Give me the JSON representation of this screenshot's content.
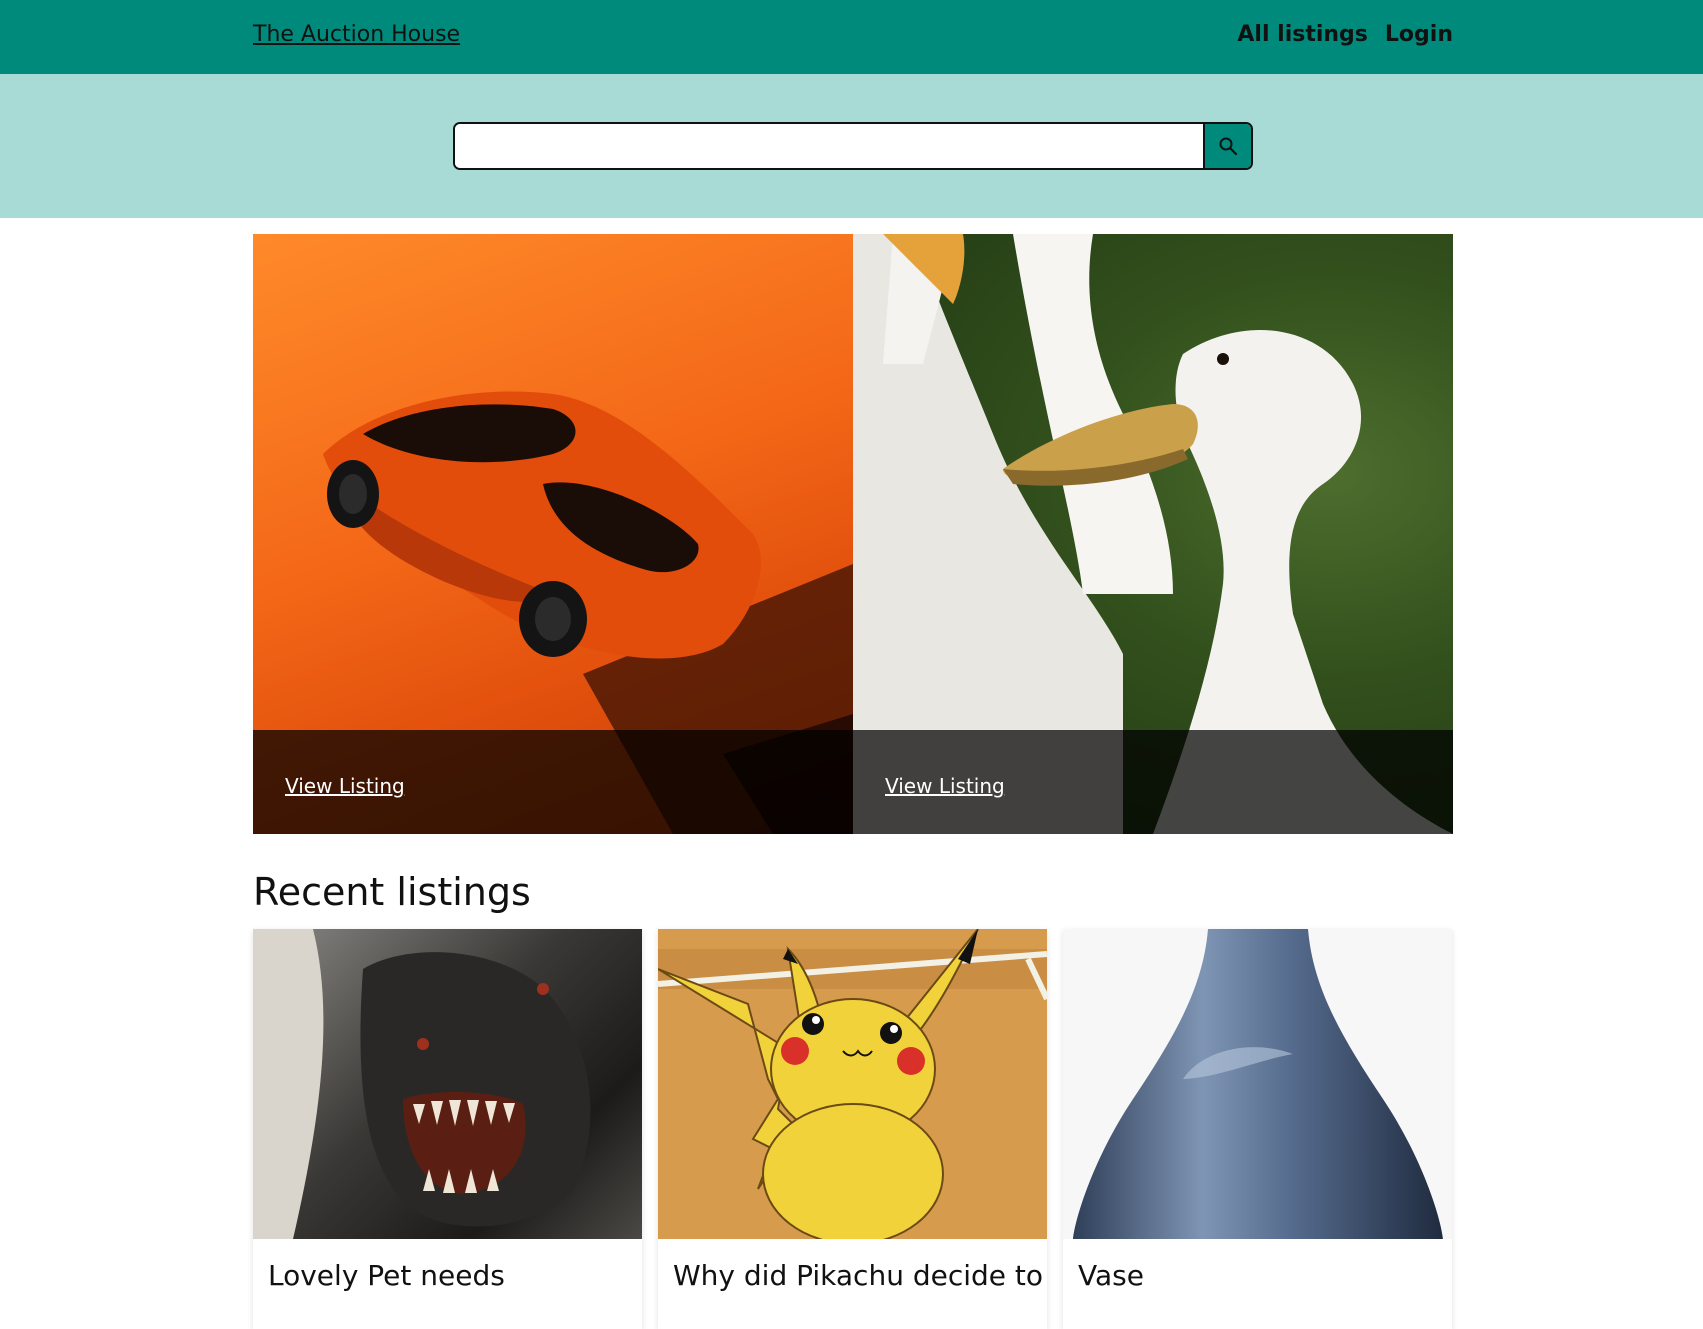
{
  "header": {
    "brand": "The Auction House",
    "nav": [
      "All listings",
      "Login"
    ]
  },
  "search": {
    "placeholder": "",
    "button_icon": "search-icon"
  },
  "hero": [
    {
      "image": "orange-sports-car-photo",
      "link_label": "View Listing"
    },
    {
      "image": "white-duck-photo",
      "link_label": "View Listing"
    }
  ],
  "recent": {
    "heading": "Recent listings",
    "cards": [
      {
        "image": "dragon-photo",
        "title": "Lovely Pet needs"
      },
      {
        "image": "pikachu-illustration",
        "title": "Why did Pikachu decide to"
      },
      {
        "image": "blue-vase-photo",
        "title": "Vase"
      }
    ]
  },
  "colors": {
    "header_bg": "#008a7c",
    "search_band_bg": "#a8dbd6"
  }
}
